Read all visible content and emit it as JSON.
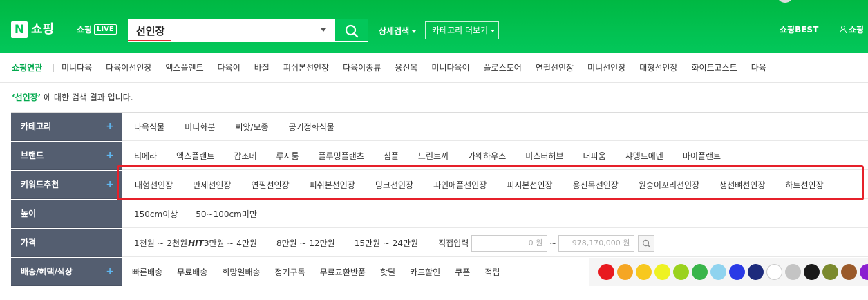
{
  "header": {
    "logo_letter": "N",
    "logo_text": "쇼핑",
    "live_text": "쇼핑",
    "live_badge": "LIVE",
    "search_value": "선인장",
    "detail_search": "상세검색",
    "category_more": "카테고리 더보기",
    "best": "쇼핑BEST",
    "user": "쇼핑"
  },
  "related": {
    "title": "쇼핑연관",
    "items": [
      "미니다육",
      "다육이선인장",
      "엑스플랜트",
      "다육이",
      "바질",
      "피쉬본선인장",
      "다육이종류",
      "용신목",
      "미니다육이",
      "플로스토어",
      "연필선인장",
      "미니선인장",
      "대형선인장",
      "화이트고스트",
      "다육"
    ]
  },
  "result": {
    "keyword": "‘선인장’",
    "suffix": " 에 대한 검색 결과 입니다."
  },
  "filters": {
    "category": {
      "label": "카테고리",
      "items": [
        "다육식물",
        "미니화분",
        "씨앗/모종",
        "공기정화식물"
      ]
    },
    "brand": {
      "label": "브랜드",
      "items": [
        "티에라",
        "엑스플랜트",
        "갑조네",
        "루시룸",
        "플루밍플랜츠",
        "심플",
        "느린토끼",
        "가웨하우스",
        "미스터허브",
        "더피움",
        "쟈뎅드에덴",
        "마이플랜트"
      ]
    },
    "keyword": {
      "label": "키워드추천",
      "items": [
        "대형선인장",
        "만세선인장",
        "연필선인장",
        "피쉬본선인장",
        "밍크선인장",
        "파인애플선인장",
        "피시본선인장",
        "용신목선인장",
        "원숭이꼬리선인장",
        "생선뼈선인장",
        "하트선인장"
      ]
    },
    "height": {
      "label": "높이",
      "items": [
        "150cm이상",
        "50~100cm미만"
      ]
    },
    "price": {
      "label": "가격",
      "items": [
        "1천원 ~ 2천원",
        "3만원 ~ 4만원",
        "8만원 ~ 12만원",
        "15만원 ~ 24만원"
      ],
      "hit": "HIT",
      "direct_input": "직접입력",
      "min_placeholder": "0 원",
      "max_placeholder": "978,170,000 원",
      "tilde": "~"
    },
    "delivery": {
      "label": "배송/혜택/색상",
      "items": [
        "빠른배송",
        "무료배송",
        "희망일배송",
        "정기구독",
        "무료교환반품",
        "핫딜",
        "카드할인",
        "쿠폰",
        "적립"
      ]
    },
    "plus": "+"
  },
  "colors": [
    "#e8191f",
    "#f5a623",
    "#f7c81e",
    "#eef222",
    "#9ad21e",
    "#39b54a",
    "#8fd3ef",
    "#2a3ae6",
    "#1d2b7c",
    "#ffffff",
    "#c4c4c4",
    "#1a1a1a",
    "#7b8a2e",
    "#9a5a2a",
    "#8a1fd0"
  ]
}
